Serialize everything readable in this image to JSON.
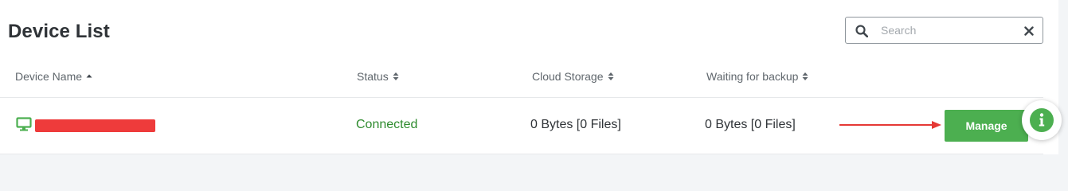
{
  "page": {
    "title": "Device List"
  },
  "search": {
    "placeholder": "Search",
    "value": ""
  },
  "table": {
    "columns": [
      {
        "label": "Device Name",
        "sort": "ascending"
      },
      {
        "label": "Status",
        "sort": "unsorted"
      },
      {
        "label": "Cloud Storage",
        "sort": "unsorted"
      },
      {
        "label": "Waiting for backup",
        "sort": "unsorted"
      }
    ],
    "rows": [
      {
        "device_icon": "monitor-icon",
        "device_name_redacted": true,
        "status": "Connected",
        "cloud_storage": "0 Bytes [0 Files]",
        "waiting_for_backup": "0 Bytes [0 Files]",
        "action_label": "Manage"
      }
    ]
  },
  "colors": {
    "accent_green": "#4caf50",
    "status_green": "#2e8b2e",
    "annotation_red": "#ee3b3b",
    "title_text": "#2f3337"
  },
  "icons": {
    "search": "search-icon",
    "clear": "close-icon",
    "sort_asc": "caret-up-icon",
    "sort_both": "sort-icon",
    "info": "info-icon",
    "arrow": "arrow-right-icon"
  }
}
